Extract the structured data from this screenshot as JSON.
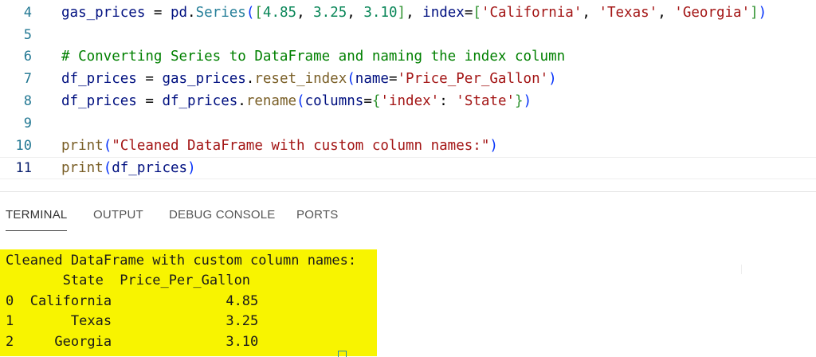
{
  "editor": {
    "lines": [
      {
        "num": "4",
        "tokens": [
          {
            "t": "gas_prices",
            "c": "var"
          },
          {
            "t": " = ",
            "c": "op"
          },
          {
            "t": "pd",
            "c": "var"
          },
          {
            "t": ".",
            "c": "op"
          },
          {
            "t": "Series",
            "c": "cls"
          },
          {
            "t": "(",
            "c": "b1"
          },
          {
            "t": "[",
            "c": "b2"
          },
          {
            "t": "4.85",
            "c": "num"
          },
          {
            "t": ", ",
            "c": "pun"
          },
          {
            "t": "3.25",
            "c": "num"
          },
          {
            "t": ", ",
            "c": "pun"
          },
          {
            "t": "3.10",
            "c": "num"
          },
          {
            "t": "]",
            "c": "b2"
          },
          {
            "t": ", ",
            "c": "pun"
          },
          {
            "t": "index",
            "c": "var"
          },
          {
            "t": "=",
            "c": "op"
          },
          {
            "t": "[",
            "c": "b2"
          },
          {
            "t": "'California'",
            "c": "str"
          },
          {
            "t": ", ",
            "c": "pun"
          },
          {
            "t": "'Texas'",
            "c": "str"
          },
          {
            "t": ", ",
            "c": "pun"
          },
          {
            "t": "'Georgia'",
            "c": "str"
          },
          {
            "t": "]",
            "c": "b2"
          },
          {
            "t": ")",
            "c": "b1"
          }
        ]
      },
      {
        "num": "5",
        "tokens": []
      },
      {
        "num": "6",
        "tokens": [
          {
            "t": "# Converting Series to DataFrame and naming the index column",
            "c": "com"
          }
        ]
      },
      {
        "num": "7",
        "tokens": [
          {
            "t": "df_prices",
            "c": "var"
          },
          {
            "t": " = ",
            "c": "op"
          },
          {
            "t": "gas_prices",
            "c": "var"
          },
          {
            "t": ".",
            "c": "op"
          },
          {
            "t": "reset_index",
            "c": "fn"
          },
          {
            "t": "(",
            "c": "b1"
          },
          {
            "t": "name",
            "c": "var"
          },
          {
            "t": "=",
            "c": "op"
          },
          {
            "t": "'Price_Per_Gallon'",
            "c": "str"
          },
          {
            "t": ")",
            "c": "b1"
          }
        ]
      },
      {
        "num": "8",
        "tokens": [
          {
            "t": "df_prices",
            "c": "var"
          },
          {
            "t": " = ",
            "c": "op"
          },
          {
            "t": "df_prices",
            "c": "var"
          },
          {
            "t": ".",
            "c": "op"
          },
          {
            "t": "rename",
            "c": "fn"
          },
          {
            "t": "(",
            "c": "b1"
          },
          {
            "t": "columns",
            "c": "var"
          },
          {
            "t": "=",
            "c": "op"
          },
          {
            "t": "{",
            "c": "b2"
          },
          {
            "t": "'index'",
            "c": "str"
          },
          {
            "t": ": ",
            "c": "pun"
          },
          {
            "t": "'State'",
            "c": "str"
          },
          {
            "t": "}",
            "c": "b2"
          },
          {
            "t": ")",
            "c": "b1"
          }
        ]
      },
      {
        "num": "9",
        "tokens": []
      },
      {
        "num": "10",
        "tokens": [
          {
            "t": "print",
            "c": "fn"
          },
          {
            "t": "(",
            "c": "b1"
          },
          {
            "t": "\"Cleaned DataFrame with custom column names:\"",
            "c": "str"
          },
          {
            "t": ")",
            "c": "b1"
          }
        ]
      },
      {
        "num": "11",
        "current": true,
        "tokens": [
          {
            "t": "print",
            "c": "fn"
          },
          {
            "t": "(",
            "c": "b1"
          },
          {
            "t": "df_prices",
            "c": "var"
          },
          {
            "t": ")",
            "c": "b1"
          }
        ]
      }
    ]
  },
  "panel": {
    "tabs": [
      {
        "label": "TERMINAL",
        "active": true
      },
      {
        "label": "OUTPUT",
        "active": false
      },
      {
        "label": "DEBUG CONSOLE",
        "active": false
      },
      {
        "label": "PORTS",
        "active": false
      }
    ]
  },
  "terminal": {
    "highlight_color": "#f8f400",
    "lines": [
      "Cleaned DataFrame with custom column names:",
      "       State  Price_Per_Gallon",
      "0  California              4.85",
      "1       Texas              3.25",
      "2     Georgia              3.10"
    ]
  }
}
